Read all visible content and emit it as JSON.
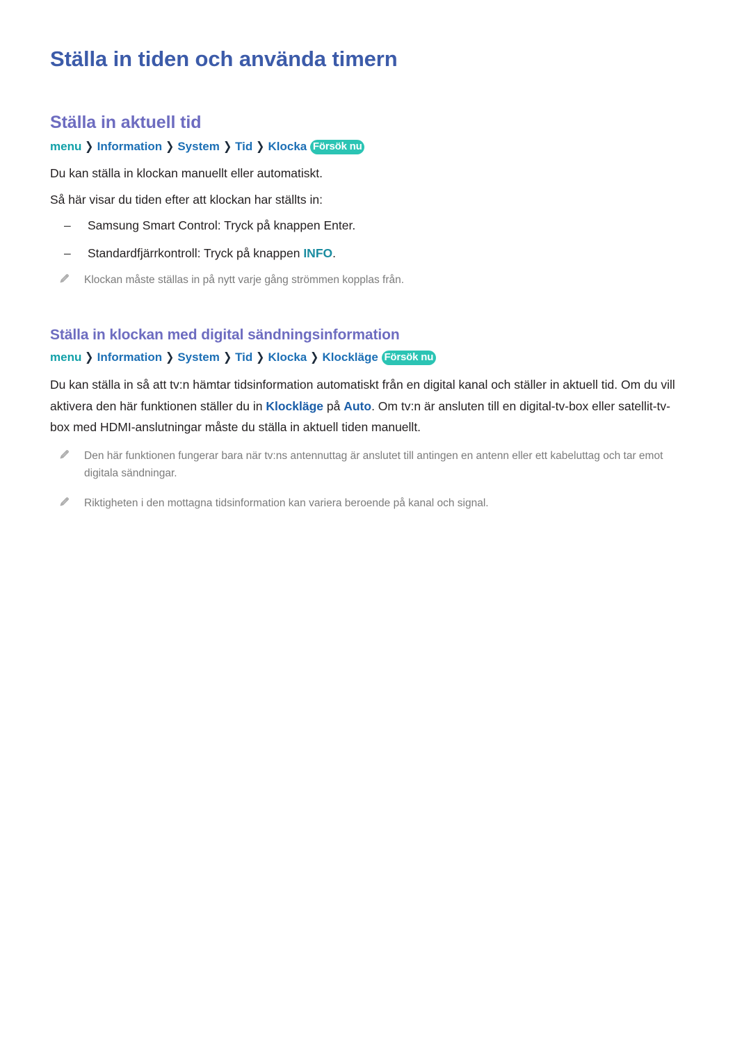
{
  "document": {
    "title": "Ställa in tiden och använda timern"
  },
  "sections": [
    {
      "heading": "Ställa in aktuell tid",
      "breadcrumb": {
        "root": "menu",
        "separator": "❯",
        "items": [
          "Information",
          "System",
          "Tid",
          "Klocka"
        ],
        "badge": "Försök nu"
      },
      "paragraphs": [
        "Du kan ställa in klockan manuellt eller automatiskt.",
        "Så här visar du tiden efter att klockan har ställts in:"
      ],
      "list": [
        {
          "dash": "–",
          "text": "Samsung Smart Control: Tryck på knappen Enter."
        },
        {
          "dash": "–",
          "text_before": "Standardfjärrkontroll: Tryck på knappen ",
          "highlight": "INFO",
          "text_after": "."
        }
      ],
      "notes": [
        {
          "icon": "pencil-icon",
          "text": "Klockan måste ställas in på nytt varje gång strömmen kopplas från."
        }
      ]
    },
    {
      "heading": "Ställa in klockan med digital sändningsinformation",
      "breadcrumb": {
        "root": "menu",
        "separator": "❯",
        "items": [
          "Information",
          "System",
          "Tid",
          "Klocka",
          "Klockläge"
        ],
        "badge": "Försök nu"
      },
      "paragraph": {
        "part1": "Du kan ställa in så att tv:n hämtar tidsinformation automatiskt från en digital kanal och ställer in aktuell tid. Om du vill aktivera den här funktionen ställer du in ",
        "bold1": "Klockläge",
        "part2": " på ",
        "bold2": "Auto",
        "part3": ". Om tv:n är ansluten till en digital-tv-box eller satellit-tv-box med HDMI-anslutningar måste du ställa in aktuell tiden manuellt."
      },
      "notes": [
        {
          "icon": "pencil-icon",
          "text": "Den här funktionen fungerar bara när tv:ns antennuttag är anslutet till antingen en antenn eller ett kabeluttag och tar emot digitala sändningar."
        },
        {
          "icon": "pencil-icon",
          "text": "Riktigheten i den mottagna tidsinformation kan variera beroende på kanal och signal."
        }
      ]
    }
  ],
  "colors": {
    "doc_title": "#3c5ba9",
    "section_heading": "#6d6cc0",
    "breadcrumb_root": "#11a0a8",
    "breadcrumb_item": "#1c6fb5",
    "badge_background": "#2bc4b4",
    "highlight_blue": "#1b5ea8",
    "highlight_teal": "#1a8ca0",
    "body_text": "#231f20",
    "note_text": "#7b7b7b"
  }
}
